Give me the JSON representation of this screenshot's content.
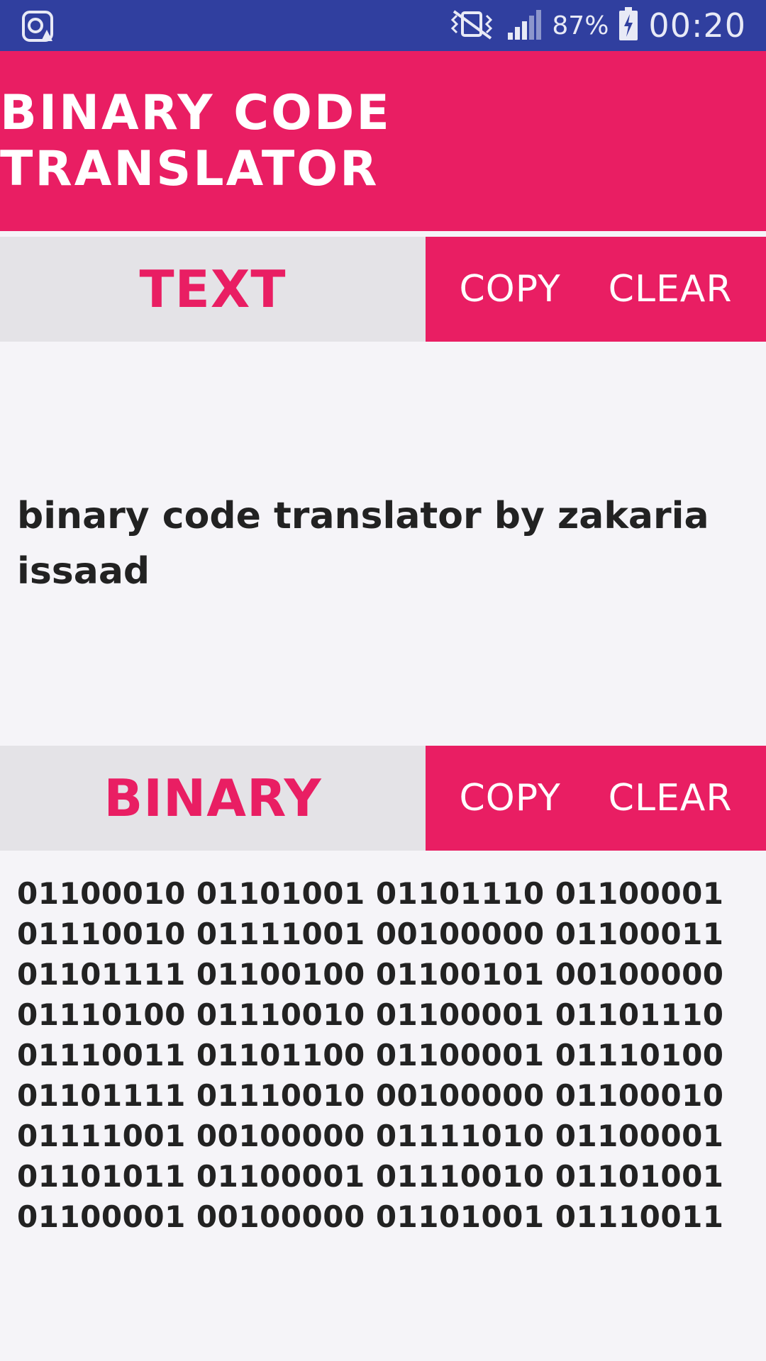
{
  "status_bar": {
    "battery_percent": "87%",
    "time": "00:20",
    "icons": [
      "app-notification-icon",
      "vibrate-icon",
      "signal-icon",
      "battery-charging-icon"
    ]
  },
  "app_bar": {
    "title": "BINARY CODE TRANSLATOR"
  },
  "text_section": {
    "label": "TEXT",
    "copy_label": "COPY",
    "clear_label": "CLEAR",
    "content": "binary code translator by zakaria issaad"
  },
  "binary_section": {
    "label": "BINARY",
    "copy_label": "COPY",
    "clear_label": "CLEAR",
    "content": "01100010 01101001 01101110 01100001 01110010 01111001 00100000 01100011 01101111 01100100 01100101 00100000 01110100 01110010 01100001 01101110 01110011 01101100 01100001 01110100 01101111 01110010 00100000 01100010 01111001 00100000 01111010 01100001 01101011 01100001 01110010 01101001 01100001 00100000 01101001 01110011"
  },
  "colors": {
    "accent": "#e91e63",
    "status_bar": "#303f9f",
    "label_background": "#e4e3e7",
    "page_background": "#f5f4f8"
  }
}
